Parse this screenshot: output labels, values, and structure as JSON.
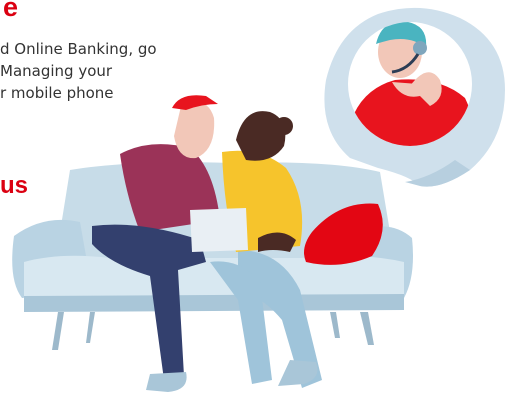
{
  "section": {
    "heading_fragment": "e",
    "body_lines": [
      "d Online Banking, go",
      "Managing your",
      "r mobile phone"
    ],
    "cta_fragment": "us"
  },
  "colors": {
    "brand_red": "#db0011",
    "agent_shirt": "#e8141e",
    "agent_headset": "#4ab4c0",
    "bubble": "#cfe0ec",
    "sofa": "#c7dce8",
    "sofa_shade": "#a9c6d8",
    "man_shirt": "#9b3358",
    "man_pants": "#33406e",
    "woman_shirt": "#f6c42c",
    "woman_pants": "#9fc4da",
    "cushion": "#e30613"
  },
  "icons": {
    "illustration": "customer-support-illustration"
  }
}
